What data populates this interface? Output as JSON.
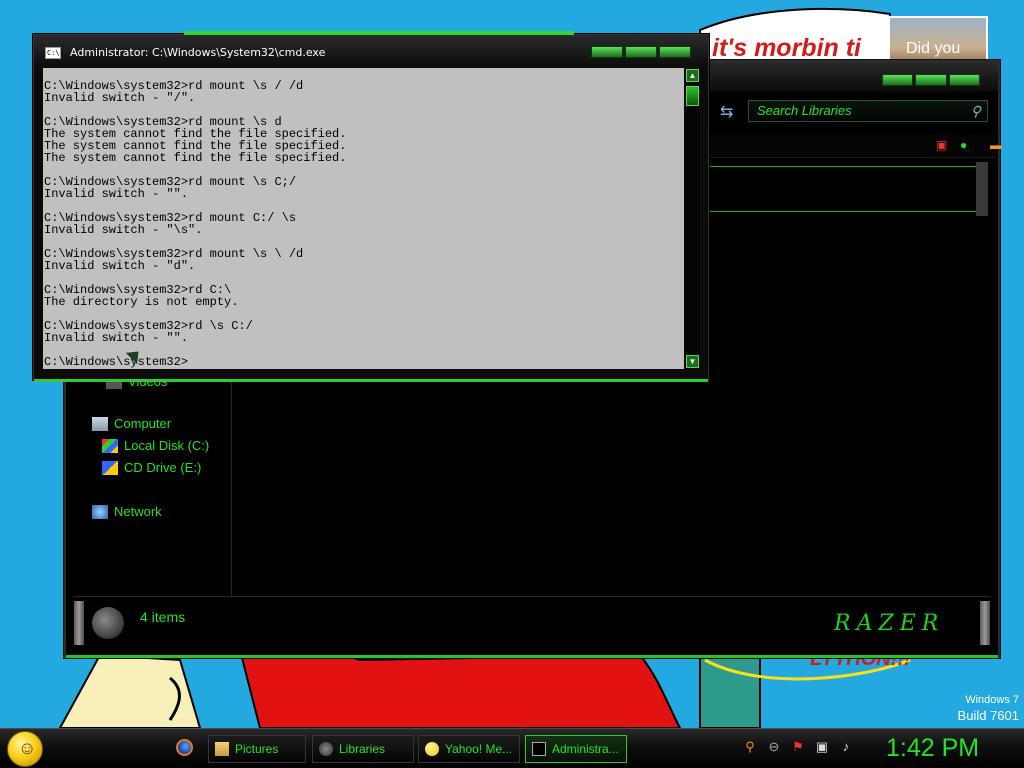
{
  "desktop": {
    "wallpaper_text": "it's morbin ti",
    "photo_caption": "Did you",
    "bottom_caption": "LYTHON!!!",
    "os_name": "Windows 7",
    "build": "Build 7601"
  },
  "cmd_window": {
    "title": "Administrator: C:\\Windows\\System32\\cmd.exe",
    "icon": "cmd-icon",
    "icon_text": "C:\\.",
    "lines": [
      "",
      "C:\\Windows\\system32>rd mount \\s / /d",
      "Invalid switch - \"/\".",
      "",
      "C:\\Windows\\system32>rd mount \\s d",
      "The system cannot find the file specified.",
      "The system cannot find the file specified.",
      "The system cannot find the file specified.",
      "",
      "C:\\Windows\\system32>rd mount \\s C;/",
      "Invalid switch - \"\".",
      "",
      "C:\\Windows\\system32>rd mount C:/ \\s",
      "Invalid switch - \"\\s\".",
      "",
      "C:\\Windows\\system32>rd mount \\s \\ /d",
      "Invalid switch - \"d\".",
      "",
      "C:\\Windows\\system32>rd C:\\",
      "The directory is not empty.",
      "",
      "C:\\Windows\\system32>rd \\s C:/",
      "Invalid switch - \"\".",
      "",
      "C:\\Windows\\system32>"
    ]
  },
  "explorer": {
    "search_placeholder": "Search Libraries",
    "nav": {
      "videos": "Videos",
      "computer": "Computer",
      "local_disk": "Local Disk (C:)",
      "cd_drive": "CD Drive (E:)",
      "network": "Network"
    },
    "status": "4 items",
    "brand": "RAZER"
  },
  "taskbar": {
    "items": [
      {
        "label": "Pictures",
        "icon": "pictures-folder-icon"
      },
      {
        "label": "Libraries",
        "icon": "libraries-icon"
      },
      {
        "label": "Yahoo! Me...",
        "icon": "yahoo-messenger-icon"
      },
      {
        "label": "Administra...",
        "icon": "cmd-icon"
      }
    ],
    "tray_icons": [
      "search-icon",
      "minus-icon",
      "action-center-flag-icon",
      "network-icon",
      "volume-icon"
    ],
    "clock": "1:42 PM"
  },
  "colors": {
    "accent_green": "#28e028",
    "desktop_blue": "#23a9e0",
    "console_bg": "#c0c0c0"
  }
}
